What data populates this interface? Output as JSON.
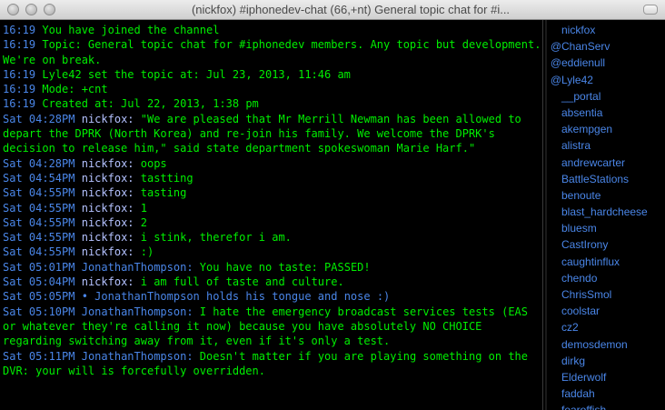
{
  "window": {
    "title": "(nickfox) #iphonedev-chat (66,+nt) General topic chat for #i..."
  },
  "messages": [
    {
      "ts": "16:19",
      "nick": "",
      "text": " You have joined the channel"
    },
    {
      "ts": "16:19",
      "nick": "",
      "text": " Topic: General topic chat for #iphonedev members. Any topic but development.  We're on break."
    },
    {
      "ts": "16:19",
      "nick": "",
      "text": " Lyle42 set the topic at: Jul 23, 2013, 11:46 am"
    },
    {
      "ts": "16:19",
      "nick": "",
      "text": " Mode: +cnt"
    },
    {
      "ts": "16:19",
      "nick": "",
      "text": " Created at: Jul 22, 2013, 1:38 pm"
    },
    {
      "ts": "Sat 04:28PM",
      "nick": "nickfox:",
      "text": " \"We are pleased that Mr Merrill Newman has been allowed to depart the DPRK (North Korea) and re-join his family. We welcome the DPRK's decision to release him,\" said state department spokeswoman Marie Harf.\""
    },
    {
      "ts": "Sat 04:28PM",
      "nick": "nickfox:",
      "text": " oops"
    },
    {
      "ts": "Sat 04:54PM",
      "nick": "nickfox:",
      "text": " tastting"
    },
    {
      "ts": "Sat 04:55PM",
      "nick": "nickfox:",
      "text": " tasting"
    },
    {
      "ts": "Sat 04:55PM",
      "nick": "nickfox:",
      "text": " 1"
    },
    {
      "ts": "Sat 04:55PM",
      "nick": "nickfox:",
      "text": " 2"
    },
    {
      "ts": "Sat 04:55PM",
      "nick": "nickfox:",
      "text": " i stink, therefor i am."
    },
    {
      "ts": "Sat 04:55PM",
      "nick": "nickfox:",
      "text": " :)"
    },
    {
      "ts": "Sat 05:01PM",
      "nick": "JonathanThompson:",
      "text": " You have no taste: PASSED!",
      "blue": true
    },
    {
      "ts": "Sat 05:04PM",
      "nick": "nickfox:",
      "text": " i am full of taste and culture."
    },
    {
      "ts": "Sat 05:05PM",
      "nick": "• JonathanThompson holds his tongue and nose :)",
      "text": "",
      "action": true
    },
    {
      "ts": "Sat 05:10PM",
      "nick": "JonathanThompson:",
      "text": " I hate the emergency broadcast services tests (EAS or whatever they're calling it now) because you have absolutely NO CHOICE regarding switching away from it, even if it's only a test.",
      "blue": true
    },
    {
      "ts": "Sat 05:11PM",
      "nick": "JonathanThompson:",
      "text": " Doesn't matter if you are playing something on the DVR: your will is forcefully overridden.",
      "blue": true
    }
  ],
  "users": [
    {
      "prefix": "",
      "name": "nickfox"
    },
    {
      "prefix": "@",
      "name": "ChanServ"
    },
    {
      "prefix": "@",
      "name": "eddienull"
    },
    {
      "prefix": "@",
      "name": "Lyle42"
    },
    {
      "prefix": "",
      "name": "__portal"
    },
    {
      "prefix": "",
      "name": "absentia"
    },
    {
      "prefix": "",
      "name": "akempgen"
    },
    {
      "prefix": "",
      "name": "alistra"
    },
    {
      "prefix": "",
      "name": "andrewcarter"
    },
    {
      "prefix": "",
      "name": "BattleStations"
    },
    {
      "prefix": "",
      "name": "benoute"
    },
    {
      "prefix": "",
      "name": "blast_hardcheese"
    },
    {
      "prefix": "",
      "name": "bluesm"
    },
    {
      "prefix": "",
      "name": "CastIrony"
    },
    {
      "prefix": "",
      "name": "caughtinflux"
    },
    {
      "prefix": "",
      "name": "chendo"
    },
    {
      "prefix": "",
      "name": "ChrisSmol"
    },
    {
      "prefix": "",
      "name": "coolstar"
    },
    {
      "prefix": "",
      "name": "cz2"
    },
    {
      "prefix": "",
      "name": "demosdemon"
    },
    {
      "prefix": "",
      "name": "dirkg"
    },
    {
      "prefix": "",
      "name": "Elderwolf"
    },
    {
      "prefix": "",
      "name": "faddah"
    },
    {
      "prefix": "",
      "name": "fearoffish"
    }
  ],
  "colors": {
    "background": "#000000",
    "message_text": "#00ee00",
    "timestamp": "#4a86e8",
    "nick": "#b4c2ff",
    "user_list": "#4a86e8"
  }
}
